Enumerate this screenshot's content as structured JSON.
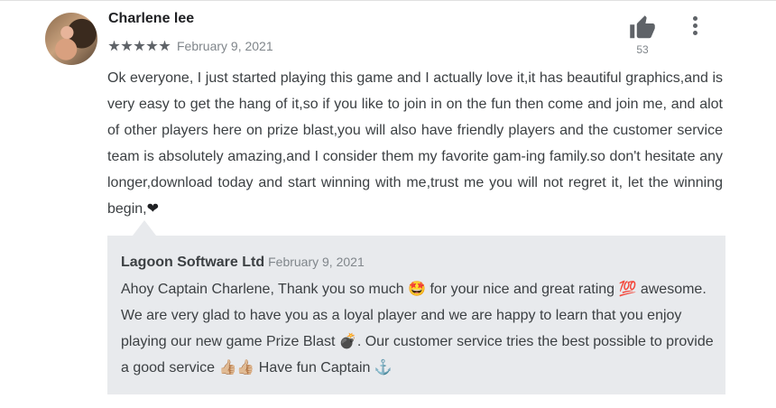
{
  "review": {
    "author": "Charlene lee",
    "stars": 5,
    "date": "February 9, 2021",
    "helpful_count": "53",
    "text": "Ok everyone, I just started playing this game and I actually love it,it has beautiful graphics,and is very easy to get the hang of it,so if you like to join in on the fun then come and join me, and alot of other players here on prize blast,you will also have friendly players and the customer service team is absolutely amazing,and I consider them my favorite gam-ing family.so don't hesitate any longer,download today and start winning with me,trust me you will not regret it, let the winning begin,",
    "heart": "❤"
  },
  "reply": {
    "developer": "Lagoon Software Ltd",
    "date": "February 9, 2021",
    "text": "Ahoy Captain Charlene, Thank you so much 🤩 for your nice and great rating 💯 awesome. We are very glad to have you as a loyal player and we are happy to learn that you enjoy playing our new game Prize Blast 💣. Our customer service tries the best possible to provide a good service 👍🏼👍🏼 Have fun Captain ⚓"
  },
  "icons": {
    "avatar": "profile-photo",
    "star": "star-icon",
    "helpful": "thumb-up-icon",
    "menu": "more-vertical-icon"
  }
}
